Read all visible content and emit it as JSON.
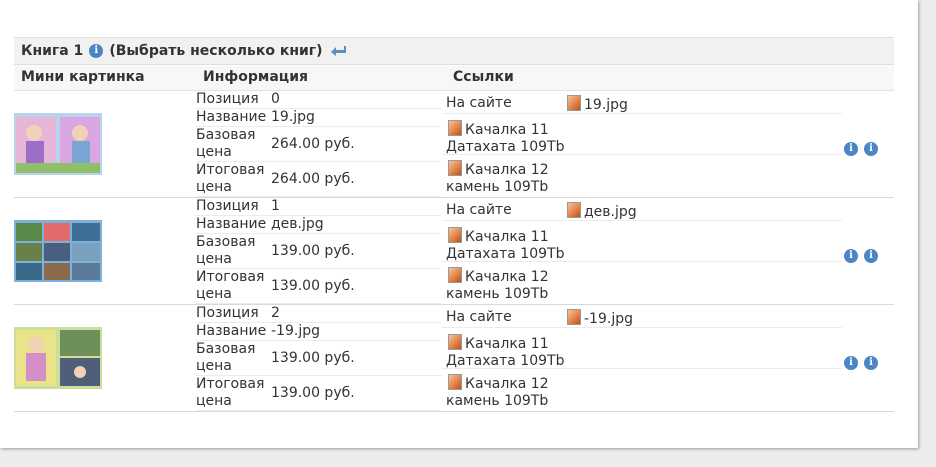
{
  "book": {
    "title": "Книга 1",
    "select_multiple": "(Выбрать несколько книг)"
  },
  "columns": {
    "thumb": "Мини картинка",
    "info": "Информация",
    "links": "Ссылки"
  },
  "labels": {
    "position": "Позиция",
    "name": "Название",
    "base_price": "Базовая цена",
    "final_price": "Итоговая цена"
  },
  "rows": [
    {
      "position": "0",
      "name": "19.jpg",
      "base_price": "264.00 руб.",
      "final_price": "264.00 руб.",
      "on_site_label": "На сайте",
      "on_site_file": "19.jpg",
      "dl1_a": "Качалка 11",
      "dl1_b": "Датахата 109Tb",
      "dl2_a": "Качалка 12",
      "dl2_b": "камень 109Tb"
    },
    {
      "position": "1",
      "name": "дев.jpg",
      "base_price": "139.00 руб.",
      "final_price": "139.00 руб.",
      "on_site_label": "На сайте",
      "on_site_file": "дев.jpg",
      "dl1_a": "Качалка 11",
      "dl1_b": "Датахата 109Tb",
      "dl2_a": "Качалка 12",
      "dl2_b": "камень 109Tb"
    },
    {
      "position": "2",
      "name": "-19.jpg",
      "base_price": "139.00 руб.",
      "final_price": "139.00 руб.",
      "on_site_label": "На сайте",
      "on_site_file": "-19.jpg",
      "dl1_a": "Качалка 11",
      "dl1_b": "Датахата 109Tb",
      "dl2_a": "Качалка 12",
      "dl2_b": "камень 109Tb"
    }
  ],
  "icons": {
    "info": "info-icon",
    "return": "return-arrow-icon",
    "file": "image-file-icon"
  },
  "colors": {
    "icon_blue": "#4a86c5"
  }
}
